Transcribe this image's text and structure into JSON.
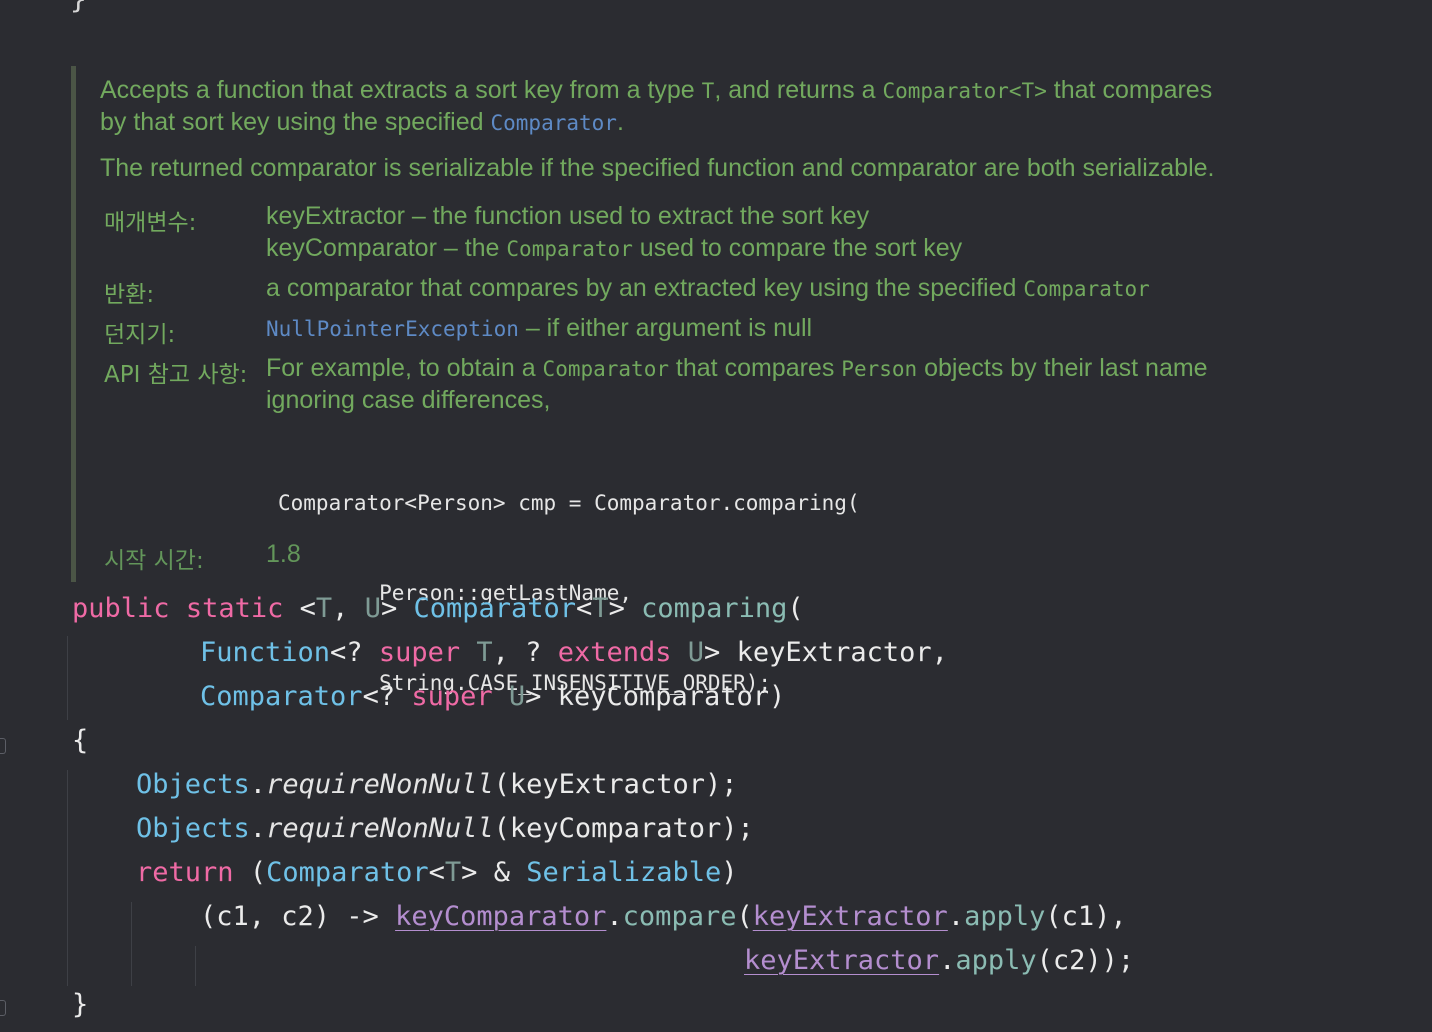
{
  "doc": {
    "summary_1": "Accepts a function that extracts a sort key from a type ",
    "summary_T": "T",
    "summary_2": ", and returns a ",
    "summary_comparatorT": "Comparator<T>",
    "summary_3": " that compares",
    "summary_4": "by that sort key using the specified ",
    "summary_link": "Comparator",
    "summary_5": ".",
    "serializable_note": "The returned comparator is serializable if the specified function and comparator are both serializable.",
    "params_label": "매개변수:",
    "param1": "keyExtractor – the function used to extract the sort key",
    "param2_a": "keyComparator – the ",
    "param2_code": "Comparator",
    "param2_b": " used to compare the sort key",
    "returns_label": "반환:",
    "returns_a": "a comparator that compares by an extracted key using the specified ",
    "returns_code": "Comparator",
    "throws_label": "던지기:",
    "throws_link": "NullPointerException",
    "throws_text": " – if either argument is null",
    "apinote_label": "API 참고 사항:",
    "apinote_a": "For example, to obtain a ",
    "apinote_code1": "Comparator",
    "apinote_b": " that compares ",
    "apinote_code2": "Person",
    "apinote_c": " objects by their last name",
    "apinote_d": "ignoring case differences,",
    "example_lines": [
      "Comparator<Person> cmp = Comparator.comparing(",
      "        Person::getLastName,",
      "        String.CASE_INSENSITIVE_ORDER);"
    ],
    "since_label": "시작 시간:",
    "since_value": "1.8"
  },
  "code": {
    "kw_public": "public",
    "kw_static": "static",
    "generic_open": "<",
    "tp_T": "T",
    "comma": ",",
    "tp_U": "U",
    "generic_close": ">",
    "type_Comparator": "Comparator",
    "method_comparing": "comparing",
    "paren_open": "(",
    "type_Function": "Function",
    "wildcard": "<?",
    "kw_super": "super",
    "q": "?",
    "kw_extends": "extends",
    "param_keyExtractor": "keyExtractor,",
    "param_keyComparator": "keyComparator)",
    "brace_open": "{",
    "type_Objects": "Objects",
    "dot": ".",
    "requireNonNull": "requireNonNull",
    "arg1": "(keyExtractor);",
    "arg2": "(keyComparator);",
    "kw_return": "return",
    "cast_open": "(",
    "amp": " & ",
    "type_Serializable": "Serializable",
    "cast_close": ")",
    "lambda_params": "(c1, c2) -> ",
    "fld_keyComparator": "keyComparator",
    "compare": "compare",
    "fld_keyExtractor": "keyExtractor",
    "apply": "apply",
    "apply_arg1": "(c1),",
    "apply_arg2": "(c2));",
    "brace_close": "}",
    "top_brace": "}"
  }
}
